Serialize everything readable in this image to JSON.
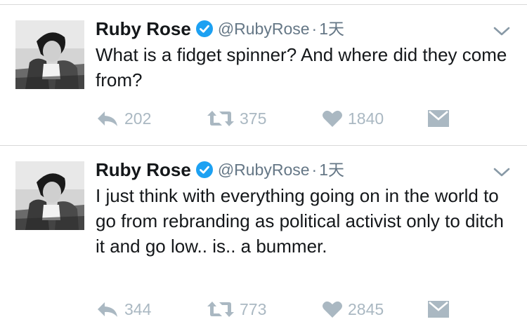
{
  "tweets": [
    {
      "author_name": "Ruby Rose",
      "handle": "@RubyRose",
      "separator": "·",
      "time": "1天",
      "text": "What is a fidget spinner? And where did they come from?",
      "replies": "202",
      "retweets": "375",
      "likes": "1840",
      "icons": [
        "reply-icon",
        "retweet-icon",
        "heart-icon",
        "message-icon",
        "verified-badge-icon",
        "chevron-down-icon"
      ]
    },
    {
      "author_name": "Ruby Rose",
      "handle": "@RubyRose",
      "separator": "·",
      "time": "1天",
      "text": "I just think with everything going on in the world to go from rebranding as political activist only to ditch it and go low.. is.. a bummer.",
      "replies": "344",
      "retweets": "773",
      "likes": "2845",
      "icons": [
        "reply-icon",
        "retweet-icon",
        "heart-icon",
        "message-icon",
        "verified-badge-icon",
        "chevron-down-icon"
      ]
    }
  ],
  "colors": {
    "text": "#14171a",
    "secondary": "#657786",
    "action": "#aab8c2",
    "verified": "#1da1f2",
    "divider": "#d9d9d9"
  }
}
